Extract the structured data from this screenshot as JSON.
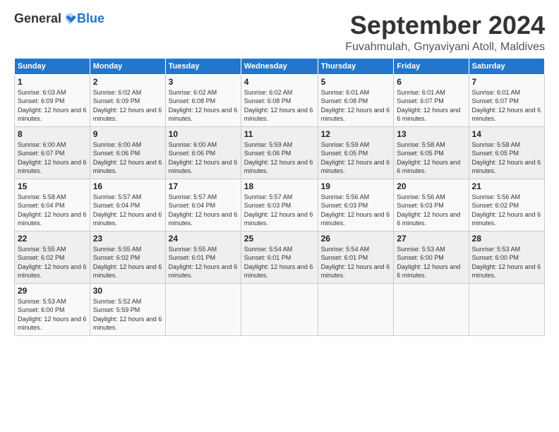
{
  "logo": {
    "general": "General",
    "blue": "Blue"
  },
  "header": {
    "month": "September 2024",
    "location": "Fuvahmulah, Gnyaviyani Atoll, Maldives"
  },
  "days_of_week": [
    "Sunday",
    "Monday",
    "Tuesday",
    "Wednesday",
    "Thursday",
    "Friday",
    "Saturday"
  ],
  "weeks": [
    [
      {
        "day": "1",
        "sunrise": "Sunrise: 6:03 AM",
        "sunset": "Sunset: 6:09 PM",
        "daylight": "Daylight: 12 hours and 6 minutes."
      },
      {
        "day": "2",
        "sunrise": "Sunrise: 6:02 AM",
        "sunset": "Sunset: 6:09 PM",
        "daylight": "Daylight: 12 hours and 6 minutes."
      },
      {
        "day": "3",
        "sunrise": "Sunrise: 6:02 AM",
        "sunset": "Sunset: 6:08 PM",
        "daylight": "Daylight: 12 hours and 6 minutes."
      },
      {
        "day": "4",
        "sunrise": "Sunrise: 6:02 AM",
        "sunset": "Sunset: 6:08 PM",
        "daylight": "Daylight: 12 hours and 6 minutes."
      },
      {
        "day": "5",
        "sunrise": "Sunrise: 6:01 AM",
        "sunset": "Sunset: 6:08 PM",
        "daylight": "Daylight: 12 hours and 6 minutes."
      },
      {
        "day": "6",
        "sunrise": "Sunrise: 6:01 AM",
        "sunset": "Sunset: 6:07 PM",
        "daylight": "Daylight: 12 hours and 6 minutes."
      },
      {
        "day": "7",
        "sunrise": "Sunrise: 6:01 AM",
        "sunset": "Sunset: 6:07 PM",
        "daylight": "Daylight: 12 hours and 6 minutes."
      }
    ],
    [
      {
        "day": "8",
        "sunrise": "Sunrise: 6:00 AM",
        "sunset": "Sunset: 6:07 PM",
        "daylight": "Daylight: 12 hours and 6 minutes."
      },
      {
        "day": "9",
        "sunrise": "Sunrise: 6:00 AM",
        "sunset": "Sunset: 6:06 PM",
        "daylight": "Daylight: 12 hours and 6 minutes."
      },
      {
        "day": "10",
        "sunrise": "Sunrise: 6:00 AM",
        "sunset": "Sunset: 6:06 PM",
        "daylight": "Daylight: 12 hours and 6 minutes."
      },
      {
        "day": "11",
        "sunrise": "Sunrise: 5:59 AM",
        "sunset": "Sunset: 6:06 PM",
        "daylight": "Daylight: 12 hours and 6 minutes."
      },
      {
        "day": "12",
        "sunrise": "Sunrise: 5:59 AM",
        "sunset": "Sunset: 6:05 PM",
        "daylight": "Daylight: 12 hours and 6 minutes."
      },
      {
        "day": "13",
        "sunrise": "Sunrise: 5:58 AM",
        "sunset": "Sunset: 6:05 PM",
        "daylight": "Daylight: 12 hours and 6 minutes."
      },
      {
        "day": "14",
        "sunrise": "Sunrise: 5:58 AM",
        "sunset": "Sunset: 6:05 PM",
        "daylight": "Daylight: 12 hours and 6 minutes."
      }
    ],
    [
      {
        "day": "15",
        "sunrise": "Sunrise: 5:58 AM",
        "sunset": "Sunset: 6:04 PM",
        "daylight": "Daylight: 12 hours and 6 minutes."
      },
      {
        "day": "16",
        "sunrise": "Sunrise: 5:57 AM",
        "sunset": "Sunset: 6:04 PM",
        "daylight": "Daylight: 12 hours and 6 minutes."
      },
      {
        "day": "17",
        "sunrise": "Sunrise: 5:57 AM",
        "sunset": "Sunset: 6:04 PM",
        "daylight": "Daylight: 12 hours and 6 minutes."
      },
      {
        "day": "18",
        "sunrise": "Sunrise: 5:57 AM",
        "sunset": "Sunset: 6:03 PM",
        "daylight": "Daylight: 12 hours and 6 minutes."
      },
      {
        "day": "19",
        "sunrise": "Sunrise: 5:56 AM",
        "sunset": "Sunset: 6:03 PM",
        "daylight": "Daylight: 12 hours and 6 minutes."
      },
      {
        "day": "20",
        "sunrise": "Sunrise: 5:56 AM",
        "sunset": "Sunset: 6:03 PM",
        "daylight": "Daylight: 12 hours and 6 minutes."
      },
      {
        "day": "21",
        "sunrise": "Sunrise: 5:56 AM",
        "sunset": "Sunset: 6:02 PM",
        "daylight": "Daylight: 12 hours and 6 minutes."
      }
    ],
    [
      {
        "day": "22",
        "sunrise": "Sunrise: 5:55 AM",
        "sunset": "Sunset: 6:02 PM",
        "daylight": "Daylight: 12 hours and 6 minutes."
      },
      {
        "day": "23",
        "sunrise": "Sunrise: 5:55 AM",
        "sunset": "Sunset: 6:02 PM",
        "daylight": "Daylight: 12 hours and 6 minutes."
      },
      {
        "day": "24",
        "sunrise": "Sunrise: 5:55 AM",
        "sunset": "Sunset: 6:01 PM",
        "daylight": "Daylight: 12 hours and 6 minutes."
      },
      {
        "day": "25",
        "sunrise": "Sunrise: 5:54 AM",
        "sunset": "Sunset: 6:01 PM",
        "daylight": "Daylight: 12 hours and 6 minutes."
      },
      {
        "day": "26",
        "sunrise": "Sunrise: 5:54 AM",
        "sunset": "Sunset: 6:01 PM",
        "daylight": "Daylight: 12 hours and 6 minutes."
      },
      {
        "day": "27",
        "sunrise": "Sunrise: 5:53 AM",
        "sunset": "Sunset: 6:00 PM",
        "daylight": "Daylight: 12 hours and 6 minutes."
      },
      {
        "day": "28",
        "sunrise": "Sunrise: 5:53 AM",
        "sunset": "Sunset: 6:00 PM",
        "daylight": "Daylight: 12 hours and 6 minutes."
      }
    ],
    [
      {
        "day": "29",
        "sunrise": "Sunrise: 5:53 AM",
        "sunset": "Sunset: 6:00 PM",
        "daylight": "Daylight: 12 hours and 6 minutes."
      },
      {
        "day": "30",
        "sunrise": "Sunrise: 5:52 AM",
        "sunset": "Sunset: 5:59 PM",
        "daylight": "Daylight: 12 hours and 6 minutes."
      },
      {
        "day": "",
        "sunrise": "",
        "sunset": "",
        "daylight": ""
      },
      {
        "day": "",
        "sunrise": "",
        "sunset": "",
        "daylight": ""
      },
      {
        "day": "",
        "sunrise": "",
        "sunset": "",
        "daylight": ""
      },
      {
        "day": "",
        "sunrise": "",
        "sunset": "",
        "daylight": ""
      },
      {
        "day": "",
        "sunrise": "",
        "sunset": "",
        "daylight": ""
      }
    ]
  ]
}
